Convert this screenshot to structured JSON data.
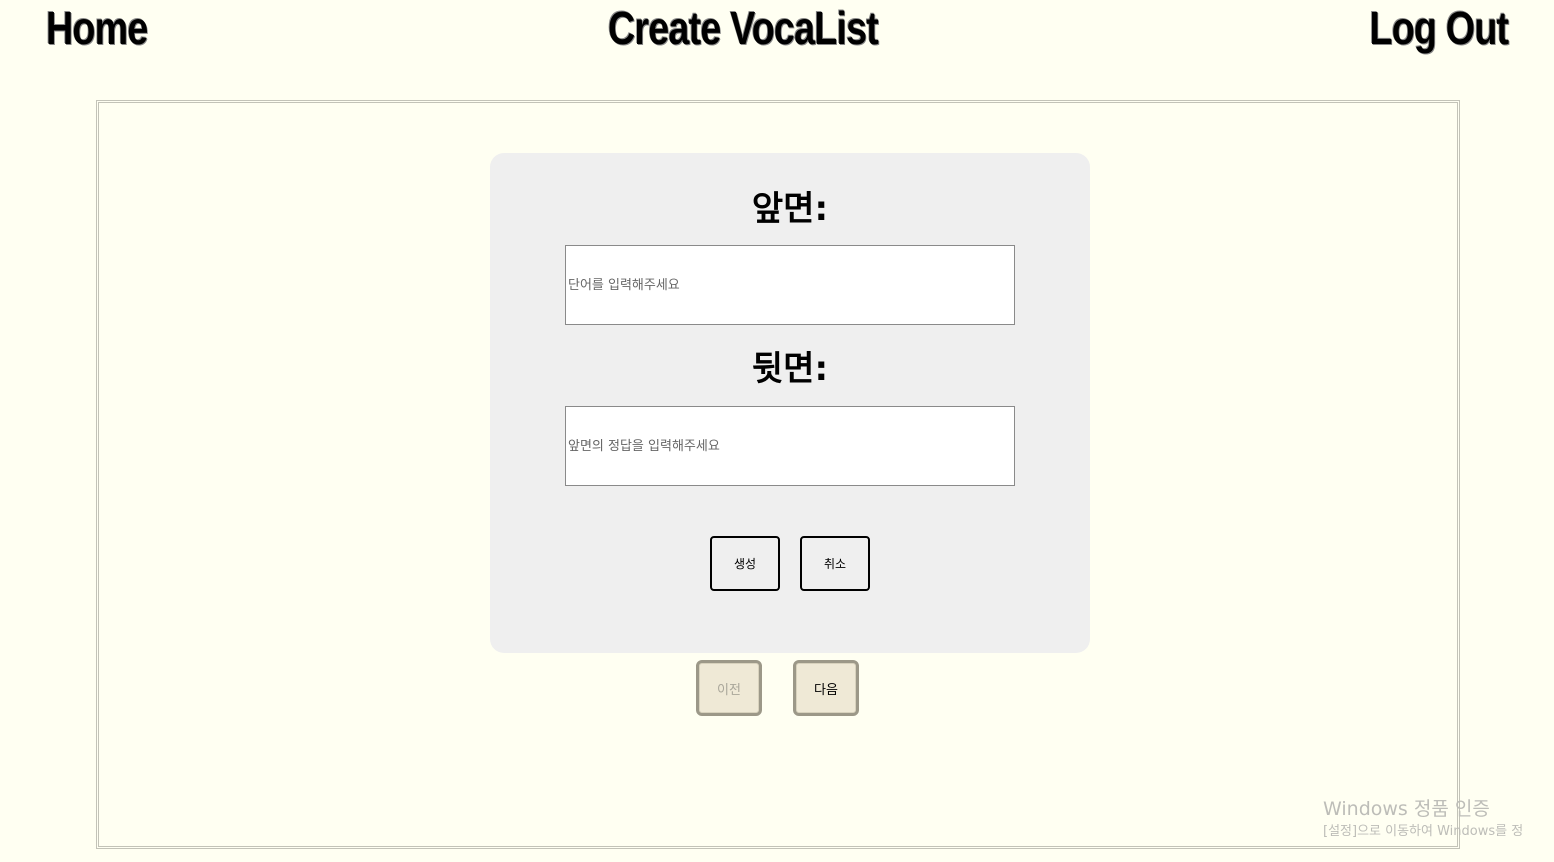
{
  "nav": {
    "home": "Home",
    "title": "Create VocaList",
    "logout": "Log Out"
  },
  "card": {
    "front_label": "앞면:",
    "front_placeholder": "단어를 입력해주세요",
    "back_label": "뒷면:",
    "back_placeholder": "앞면의 정답을 입력해주세요",
    "create_button": "생성",
    "cancel_button": "취소"
  },
  "pager": {
    "prev": "이전",
    "next": "다음"
  },
  "watermark": {
    "line1": "Windows 정품 인증",
    "line2": "[설정]으로 이동하여 Windows를 정"
  },
  "colors": {
    "page_background": "#fffff2",
    "card_background": "#efefef",
    "pager_button": "#efe9d6"
  }
}
